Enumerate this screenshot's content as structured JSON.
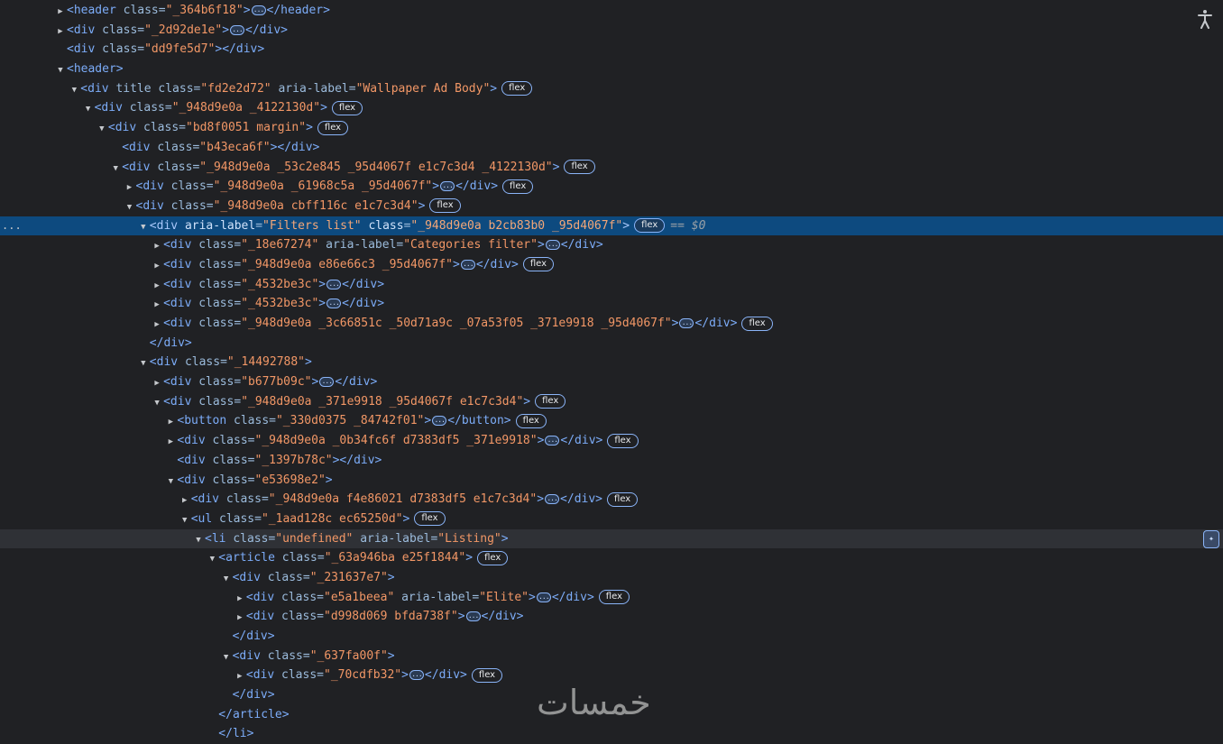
{
  "rows": [
    {
      "i": 0,
      "a": "c",
      "p": [
        [
          "t",
          "<header "
        ],
        [
          "a",
          "class"
        ],
        [
          "e",
          "="
        ],
        [
          "v",
          "\"_364b6f18\""
        ],
        [
          "t",
          ">"
        ],
        [
          "x",
          "..."
        ],
        [
          "t",
          "</header>"
        ]
      ]
    },
    {
      "i": 0,
      "a": "c",
      "p": [
        [
          "t",
          "<div "
        ],
        [
          "a",
          "class"
        ],
        [
          "e",
          "="
        ],
        [
          "v",
          "\"_2d92de1e\""
        ],
        [
          "t",
          ">"
        ],
        [
          "x",
          "..."
        ],
        [
          "t",
          "</div>"
        ]
      ]
    },
    {
      "i": 0,
      "a": "n",
      "p": [
        [
          "t",
          "<div "
        ],
        [
          "a",
          "class"
        ],
        [
          "e",
          "="
        ],
        [
          "v",
          "\"dd9fe5d7\""
        ],
        [
          "t",
          "></div>"
        ]
      ]
    },
    {
      "i": 0,
      "a": "o",
      "p": [
        [
          "t",
          "<header>"
        ]
      ]
    },
    {
      "i": 1,
      "a": "o",
      "p": [
        [
          "t",
          "<div "
        ],
        [
          "a",
          "title class"
        ],
        [
          "e",
          "="
        ],
        [
          "v",
          "\"fd2e2d72\""
        ],
        [
          "a",
          " aria-label"
        ],
        [
          "e",
          "="
        ],
        [
          "v",
          "\"Wallpaper Ad Body\""
        ],
        [
          "t",
          ">"
        ]
      ],
      "b": "flex"
    },
    {
      "i": 2,
      "a": "o",
      "p": [
        [
          "t",
          "<div "
        ],
        [
          "a",
          "class"
        ],
        [
          "e",
          "="
        ],
        [
          "v",
          "\"_948d9e0a _4122130d\""
        ],
        [
          "t",
          ">"
        ]
      ],
      "b": "flex"
    },
    {
      "i": 3,
      "a": "o",
      "p": [
        [
          "t",
          "<div "
        ],
        [
          "a",
          "class"
        ],
        [
          "e",
          "="
        ],
        [
          "v",
          "\"bd8f0051 margin\""
        ],
        [
          "t",
          ">"
        ]
      ],
      "b": "flex"
    },
    {
      "i": 4,
      "a": "n",
      "p": [
        [
          "t",
          "<div "
        ],
        [
          "a",
          "class"
        ],
        [
          "e",
          "="
        ],
        [
          "v",
          "\"b43eca6f\""
        ],
        [
          "t",
          "></div>"
        ]
      ]
    },
    {
      "i": 4,
      "a": "o",
      "p": [
        [
          "t",
          "<div "
        ],
        [
          "a",
          "class"
        ],
        [
          "e",
          "="
        ],
        [
          "v",
          "\"_948d9e0a _53c2e845 _95d4067f e1c7c3d4 _4122130d\""
        ],
        [
          "t",
          ">"
        ]
      ],
      "b": "flex"
    },
    {
      "i": 5,
      "a": "c",
      "p": [
        [
          "t",
          "<div "
        ],
        [
          "a",
          "class"
        ],
        [
          "e",
          "="
        ],
        [
          "v",
          "\"_948d9e0a _61968c5a _95d4067f\""
        ],
        [
          "t",
          ">"
        ],
        [
          "x",
          "..."
        ],
        [
          "t",
          "</div>"
        ]
      ],
      "b": "flex"
    },
    {
      "i": 5,
      "a": "o",
      "p": [
        [
          "t",
          "<div "
        ],
        [
          "a",
          "class"
        ],
        [
          "e",
          "="
        ],
        [
          "v",
          "\"_948d9e0a cbff116c e1c7c3d4\""
        ],
        [
          "t",
          ">"
        ]
      ],
      "b": "flex"
    },
    {
      "i": 6,
      "a": "o",
      "sel": true,
      "gut": "...",
      "p": [
        [
          "t",
          "<div "
        ],
        [
          "a",
          "aria-label"
        ],
        [
          "e",
          "="
        ],
        [
          "v",
          "\"Filters list\""
        ],
        [
          "a",
          " class"
        ],
        [
          "e",
          "="
        ],
        [
          "v",
          "\"_948d9e0a b2cb83b0 _95d4067f\""
        ],
        [
          "t",
          ">"
        ]
      ],
      "b": "flex",
      "d": "== ",
      "dv": "$0"
    },
    {
      "i": 7,
      "a": "c",
      "p": [
        [
          "t",
          "<div "
        ],
        [
          "a",
          "class"
        ],
        [
          "e",
          "="
        ],
        [
          "v",
          "\"_18e67274\""
        ],
        [
          "a",
          " aria-label"
        ],
        [
          "e",
          "="
        ],
        [
          "v",
          "\"Categories filter\""
        ],
        [
          "t",
          ">"
        ],
        [
          "x",
          "..."
        ],
        [
          "t",
          "</div>"
        ]
      ]
    },
    {
      "i": 7,
      "a": "c",
      "p": [
        [
          "t",
          "<div "
        ],
        [
          "a",
          "class"
        ],
        [
          "e",
          "="
        ],
        [
          "v",
          "\"_948d9e0a e86e66c3 _95d4067f\""
        ],
        [
          "t",
          ">"
        ],
        [
          "x",
          "..."
        ],
        [
          "t",
          "</div>"
        ]
      ],
      "b": "flex"
    },
    {
      "i": 7,
      "a": "c",
      "p": [
        [
          "t",
          "<div "
        ],
        [
          "a",
          "class"
        ],
        [
          "e",
          "="
        ],
        [
          "v",
          "\"_4532be3c\""
        ],
        [
          "t",
          ">"
        ],
        [
          "x",
          "..."
        ],
        [
          "t",
          "</div>"
        ]
      ]
    },
    {
      "i": 7,
      "a": "c",
      "p": [
        [
          "t",
          "<div "
        ],
        [
          "a",
          "class"
        ],
        [
          "e",
          "="
        ],
        [
          "v",
          "\"_4532be3c\""
        ],
        [
          "t",
          ">"
        ],
        [
          "x",
          "..."
        ],
        [
          "t",
          "</div>"
        ]
      ]
    },
    {
      "i": 7,
      "a": "c",
      "p": [
        [
          "t",
          "<div "
        ],
        [
          "a",
          "class"
        ],
        [
          "e",
          "="
        ],
        [
          "v",
          "\"_948d9e0a _3c66851c _50d71a9c _07a53f05 _371e9918 _95d4067f\""
        ],
        [
          "t",
          ">"
        ],
        [
          "x",
          "..."
        ],
        [
          "t",
          "</div>"
        ]
      ],
      "b": "flex"
    },
    {
      "i": 6,
      "a": "n",
      "p": [
        [
          "t",
          "</div>"
        ]
      ]
    },
    {
      "i": 6,
      "a": "o",
      "p": [
        [
          "t",
          "<div "
        ],
        [
          "a",
          "class"
        ],
        [
          "e",
          "="
        ],
        [
          "v",
          "\"_14492788\""
        ],
        [
          "t",
          ">"
        ]
      ]
    },
    {
      "i": 7,
      "a": "c",
      "p": [
        [
          "t",
          "<div "
        ],
        [
          "a",
          "class"
        ],
        [
          "e",
          "="
        ],
        [
          "v",
          "\"b677b09c\""
        ],
        [
          "t",
          ">"
        ],
        [
          "x",
          "..."
        ],
        [
          "t",
          "</div>"
        ]
      ]
    },
    {
      "i": 7,
      "a": "o",
      "p": [
        [
          "t",
          "<div "
        ],
        [
          "a",
          "class"
        ],
        [
          "e",
          "="
        ],
        [
          "v",
          "\"_948d9e0a _371e9918 _95d4067f e1c7c3d4\""
        ],
        [
          "t",
          ">"
        ]
      ],
      "b": "flex"
    },
    {
      "i": 8,
      "a": "c",
      "p": [
        [
          "t",
          "<button "
        ],
        [
          "a",
          "class"
        ],
        [
          "e",
          "="
        ],
        [
          "v",
          "\"_330d0375 _84742f01\""
        ],
        [
          "t",
          ">"
        ],
        [
          "x",
          "..."
        ],
        [
          "t",
          "</button>"
        ]
      ],
      "b": "flex"
    },
    {
      "i": 8,
      "a": "c",
      "p": [
        [
          "t",
          "<div "
        ],
        [
          "a",
          "class"
        ],
        [
          "e",
          "="
        ],
        [
          "v",
          "\"_948d9e0a _0b34fc6f d7383df5 _371e9918\""
        ],
        [
          "t",
          ">"
        ],
        [
          "x",
          "..."
        ],
        [
          "t",
          "</div>"
        ]
      ],
      "b": "flex"
    },
    {
      "i": 8,
      "a": "n",
      "p": [
        [
          "t",
          "<div "
        ],
        [
          "a",
          "class"
        ],
        [
          "e",
          "="
        ],
        [
          "v",
          "\"_1397b78c\""
        ],
        [
          "t",
          "></div>"
        ]
      ]
    },
    {
      "i": 8,
      "a": "o",
      "p": [
        [
          "t",
          "<div "
        ],
        [
          "a",
          "class"
        ],
        [
          "e",
          "="
        ],
        [
          "v",
          "\"e53698e2\""
        ],
        [
          "t",
          ">"
        ]
      ]
    },
    {
      "i": 9,
      "a": "c",
      "p": [
        [
          "t",
          "<div "
        ],
        [
          "a",
          "class"
        ],
        [
          "e",
          "="
        ],
        [
          "v",
          "\"_948d9e0a f4e86021 d7383df5 e1c7c3d4\""
        ],
        [
          "t",
          ">"
        ],
        [
          "x",
          "..."
        ],
        [
          "t",
          "</div>"
        ]
      ],
      "b": "flex"
    },
    {
      "i": 9,
      "a": "o",
      "p": [
        [
          "t",
          "<ul "
        ],
        [
          "a",
          "class"
        ],
        [
          "e",
          "="
        ],
        [
          "v",
          "\"_1aad128c ec65250d\""
        ],
        [
          "t",
          ">"
        ]
      ],
      "b": "flex"
    },
    {
      "i": 10,
      "a": "o",
      "hov": true,
      "p": [
        [
          "t",
          "<li "
        ],
        [
          "a",
          "class"
        ],
        [
          "e",
          "="
        ],
        [
          "v",
          "\"undefined\""
        ],
        [
          "a",
          " aria-label"
        ],
        [
          "e",
          "="
        ],
        [
          "v",
          "\"Listing\""
        ],
        [
          "t",
          ">"
        ]
      ]
    },
    {
      "i": 11,
      "a": "o",
      "p": [
        [
          "t",
          "<article "
        ],
        [
          "a",
          "class"
        ],
        [
          "e",
          "="
        ],
        [
          "v",
          "\"_63a946ba e25f1844\""
        ],
        [
          "t",
          ">"
        ]
      ],
      "b": "flex"
    },
    {
      "i": 12,
      "a": "o",
      "p": [
        [
          "t",
          "<div "
        ],
        [
          "a",
          "class"
        ],
        [
          "e",
          "="
        ],
        [
          "v",
          "\"_231637e7\""
        ],
        [
          "t",
          ">"
        ]
      ]
    },
    {
      "i": 13,
      "a": "c",
      "p": [
        [
          "t",
          "<div "
        ],
        [
          "a",
          "class"
        ],
        [
          "e",
          "="
        ],
        [
          "v",
          "\"e5a1beea\""
        ],
        [
          "a",
          " aria-label"
        ],
        [
          "e",
          "="
        ],
        [
          "v",
          "\"Elite\""
        ],
        [
          "t",
          ">"
        ],
        [
          "x",
          "..."
        ],
        [
          "t",
          "</div>"
        ]
      ],
      "b": "flex"
    },
    {
      "i": 13,
      "a": "c",
      "p": [
        [
          "t",
          "<div "
        ],
        [
          "a",
          "class"
        ],
        [
          "e",
          "="
        ],
        [
          "v",
          "\"d998d069 bfda738f\""
        ],
        [
          "t",
          ">"
        ],
        [
          "x",
          "..."
        ],
        [
          "t",
          "</div>"
        ]
      ]
    },
    {
      "i": 12,
      "a": "n",
      "p": [
        [
          "t",
          "</div>"
        ]
      ]
    },
    {
      "i": 12,
      "a": "o",
      "p": [
        [
          "t",
          "<div "
        ],
        [
          "a",
          "class"
        ],
        [
          "e",
          "="
        ],
        [
          "v",
          "\"_637fa00f\""
        ],
        [
          "t",
          ">"
        ]
      ]
    },
    {
      "i": 13,
      "a": "c",
      "p": [
        [
          "t",
          "<div "
        ],
        [
          "a",
          "class"
        ],
        [
          "e",
          "="
        ],
        [
          "v",
          "\"_70cdfb32\""
        ],
        [
          "t",
          ">"
        ],
        [
          "x",
          "..."
        ],
        [
          "t",
          "</div>"
        ]
      ],
      "b": "flex"
    },
    {
      "i": 12,
      "a": "n",
      "p": [
        [
          "t",
          "</div>"
        ]
      ]
    },
    {
      "i": 11,
      "a": "n",
      "p": [
        [
          "t",
          "</article>"
        ]
      ]
    },
    {
      "i": 11,
      "a": "n",
      "p": [
        [
          "t",
          "</li>"
        ]
      ]
    }
  ],
  "watermark": "خمسات",
  "icons": {
    "accessibility": "accessibility-icon",
    "ai_assist": "ai-assistance-icon"
  }
}
